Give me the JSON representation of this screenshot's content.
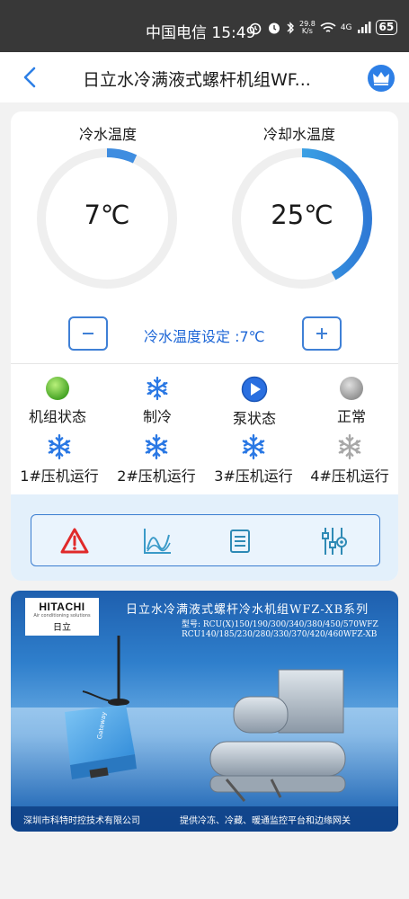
{
  "status_bar": {
    "carrier": "中国电信 15:49",
    "net_speed_value": "29.8",
    "net_speed_unit": "K/s",
    "network": "4G",
    "battery": "65"
  },
  "header": {
    "title": "日立水冷满液式螺杆机组WF..."
  },
  "gauges": [
    {
      "label": "冷水温度",
      "value": "7℃",
      "fill_fraction": 0.07,
      "color": "#3f8de0"
    },
    {
      "label": "冷却水温度",
      "value": "25℃",
      "fill_fraction": 0.42,
      "color": "#35a6ea"
    }
  ],
  "setpoint": {
    "label": "冷水温度设定 :7℃"
  },
  "status_row": [
    {
      "label": "机组状态",
      "icon": "green-status-dot-icon"
    },
    {
      "label": "制冷",
      "icon": "snowflake-icon"
    },
    {
      "label": "泵状态",
      "icon": "play-circle-icon"
    },
    {
      "label": "正常",
      "icon": "gray-status-dot-icon"
    }
  ],
  "compressors": [
    {
      "label": "1#压机运行",
      "active": true
    },
    {
      "label": "2#压机运行",
      "active": true
    },
    {
      "label": "3#压机运行",
      "active": true
    },
    {
      "label": "4#压机运行",
      "active": false
    }
  ],
  "toolbar": [
    {
      "icon": "alarm-warning-icon"
    },
    {
      "icon": "trend-chart-icon"
    },
    {
      "icon": "list-document-icon"
    },
    {
      "icon": "settings-sliders-icon"
    }
  ],
  "banner": {
    "logo_brand": "HITACHI",
    "logo_tagline": "Air conditioning solutions",
    "logo_cn": "日立",
    "title": "日立水冷满液式螺杆冷水机组WFZ-XB系列",
    "model_line1": "型号: RCU(X)150/190/300/340/380/450/570WFZ",
    "model_line2": "RCU140/185/230/280/330/370/420/460WFZ-XB",
    "footer_left": "深圳市科特时控技术有限公司",
    "footer_right": "提供冷冻、冷藏、暖通监控平台和边缘网关"
  },
  "colors": {
    "accent": "#2d7fe6",
    "snowflake_active": "#2a78e4",
    "snowflake_inactive": "#a8a8a8",
    "toolbar_bg": "#e3f0fb",
    "alarm": "#e02a2a"
  }
}
